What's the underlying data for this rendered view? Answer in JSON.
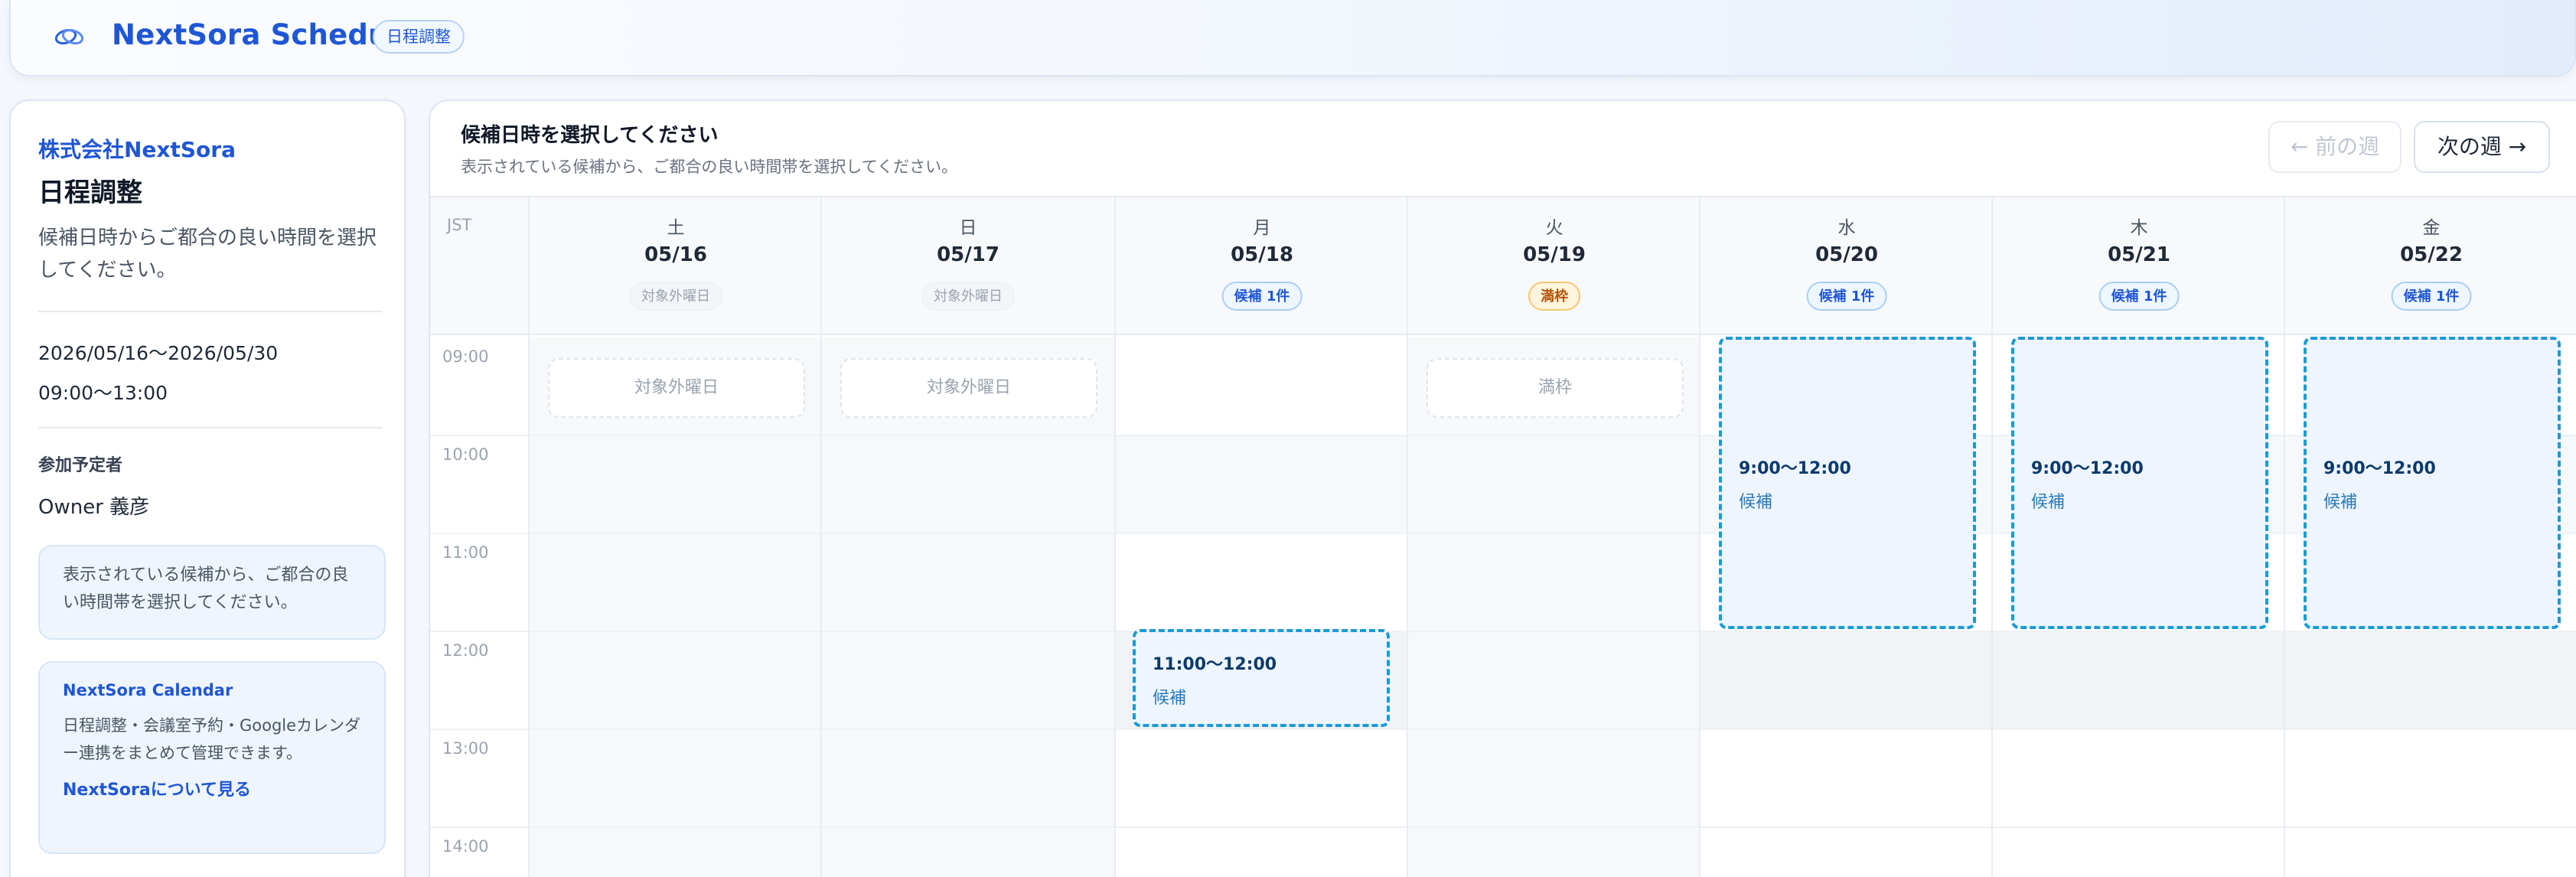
{
  "header": {
    "title": "NextSora Schedule",
    "badge": "日程調整"
  },
  "sidebar": {
    "company": "株式会社NextSora",
    "title": "日程調整",
    "description": "候補日時からご都合の良い時間を選択してください。",
    "date_range": "2026/05/16〜2026/05/30",
    "time_range": "09:00〜13:00",
    "participants_label": "参加予定者",
    "participant": "Owner 義彦",
    "info": "表示されている候補から、ご都合の良い時間帯を選択してください。",
    "promo": {
      "title": "NextSora Calendar",
      "description": "日程調整・会議室予約・Googleカレンダー連携をまとめて管理できます。",
      "link": "NextSoraについて見る"
    }
  },
  "main": {
    "title": "候補日時を選択してください",
    "subtitle": "表示されている候補から、ご都合の良い時間帯を選択してください。",
    "prev_week": "← 前の週",
    "next_week": "次の週 →",
    "timezone": "JST",
    "times": [
      "09:00",
      "10:00",
      "11:00",
      "12:00",
      "13:00",
      "14:00"
    ],
    "days": [
      {
        "dow": "土",
        "date": "05/16",
        "badge": "対象外曜日",
        "status": "out",
        "ghost": "対象外曜日"
      },
      {
        "dow": "日",
        "date": "05/17",
        "badge": "対象外曜日",
        "status": "out",
        "ghost": "対象外曜日"
      },
      {
        "dow": "月",
        "date": "05/18",
        "badge": "候補 1件",
        "status": "cand",
        "slot_time": "11:00〜12:00",
        "slot_label": "候補"
      },
      {
        "dow": "火",
        "date": "05/19",
        "badge": "満枠",
        "status": "full",
        "ghost": "満枠"
      },
      {
        "dow": "水",
        "date": "05/20",
        "badge": "候補 1件",
        "status": "cand",
        "slot_time": "9:00〜12:00",
        "slot_label": "候補"
      },
      {
        "dow": "木",
        "date": "05/21",
        "badge": "候補 1件",
        "status": "cand",
        "slot_time": "9:00〜12:00",
        "slot_label": "候補"
      },
      {
        "dow": "金",
        "date": "05/22",
        "badge": "候補 1件",
        "status": "cand",
        "slot_time": "9:00〜12:00",
        "slot_label": "候補"
      }
    ]
  },
  "colors": {
    "brand": "#1f56d6",
    "slot_border": "#1a9ad6",
    "full_badge": "#b45309"
  }
}
